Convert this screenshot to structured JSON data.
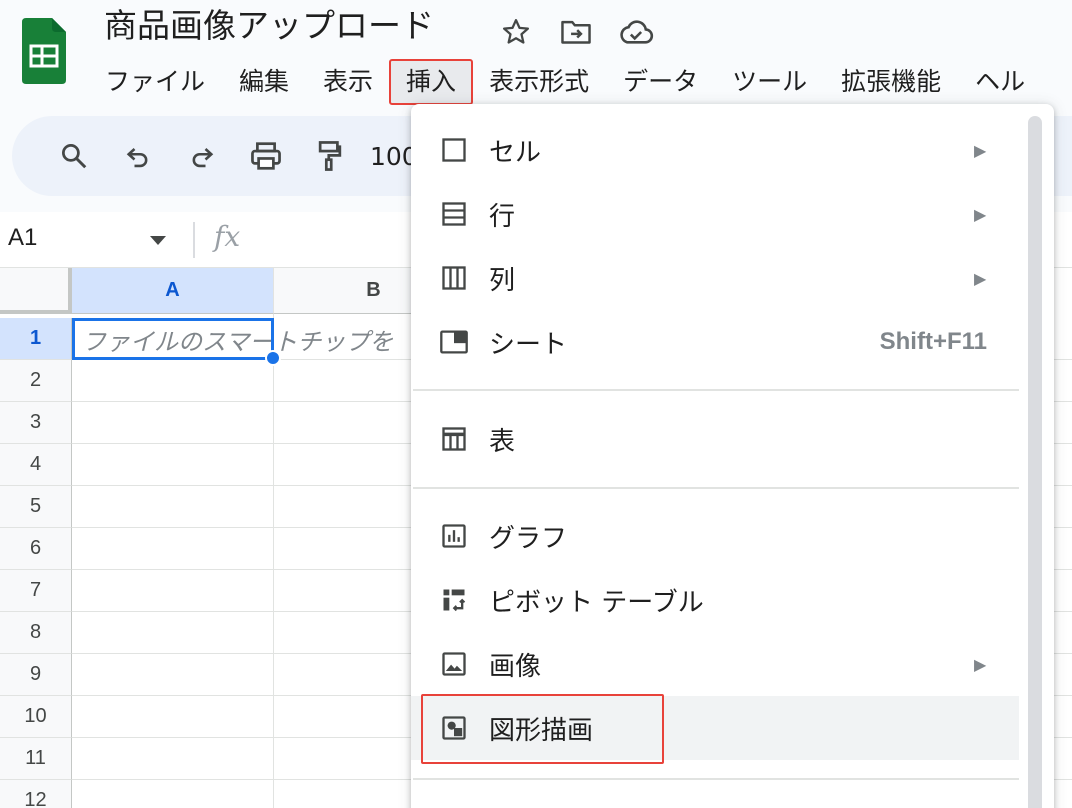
{
  "document": {
    "title": "商品画像アップロード"
  },
  "menubar": {
    "items": [
      "ファイル",
      "編集",
      "表示",
      "挿入",
      "表示形式",
      "データ",
      "ツール",
      "拡張機能",
      "ヘル"
    ]
  },
  "toolbar": {
    "zoom": "100"
  },
  "formula_bar": {
    "name_box": "A1",
    "fx_label": "fx"
  },
  "grid": {
    "columns": [
      "A",
      "B"
    ],
    "rows": [
      "1",
      "2",
      "3",
      "4",
      "5",
      "6",
      "7",
      "8",
      "9",
      "10",
      "11",
      "12"
    ],
    "a1_placeholder": "ファイルのスマートチップを"
  },
  "insert_menu": {
    "cell": "セル",
    "row": "行",
    "column": "列",
    "sheet": "シート",
    "sheet_shortcut": "Shift+F11",
    "table": "表",
    "chart": "グラフ",
    "pivot_table": "ピボット テーブル",
    "image": "画像",
    "drawing": "図形描画"
  },
  "colors": {
    "accent": "#1a73e8",
    "highlight": "#e8423a",
    "brand_green": "#188038"
  }
}
